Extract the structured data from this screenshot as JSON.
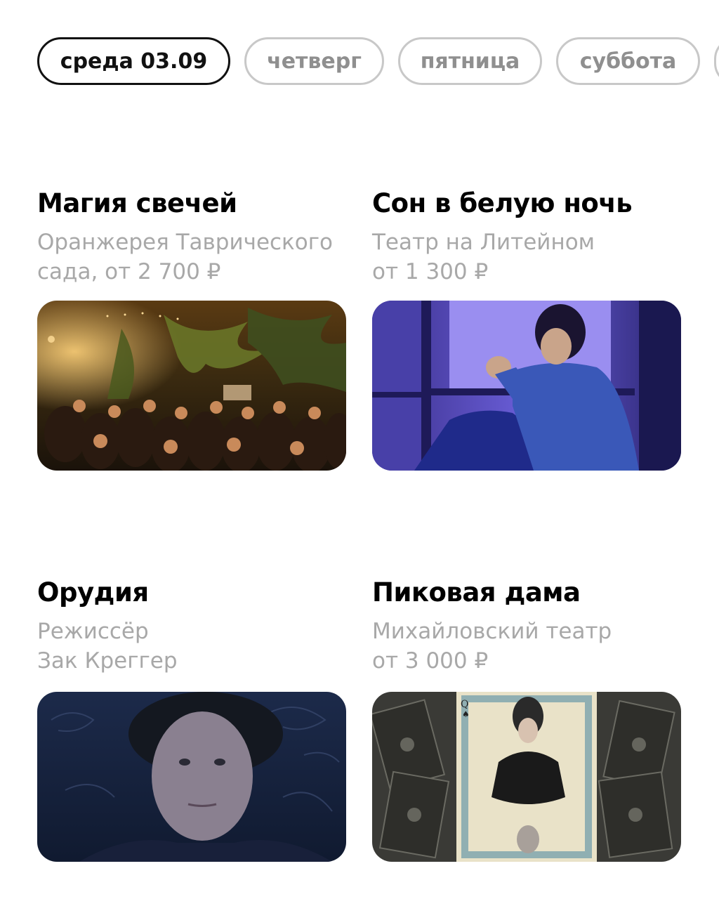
{
  "days": [
    {
      "label": "среда 03.09",
      "active": true
    },
    {
      "label": "четверг",
      "active": false
    },
    {
      "label": "пятница",
      "active": false
    },
    {
      "label": "суббота",
      "active": false
    }
  ],
  "events": [
    {
      "title": "Магия свечей",
      "line1": "Оранжерея Таврического",
      "line2": "сада, от 2 700 ₽"
    },
    {
      "title": "Сон в белую ночь",
      "line1": "Театр на Литейном",
      "line2": "от 1 300 ₽"
    },
    {
      "title": "Орудия",
      "line1": "Режиссёр",
      "line2": "Зак Креггер"
    },
    {
      "title": "Пиковая дама",
      "line1": "Михайловский театр",
      "line2": "от 3 000 ₽"
    }
  ],
  "colors": {
    "active_border": "#111111",
    "inactive_border": "#c8c8c8",
    "inactive_text": "#8f8f8f",
    "subtitle": "#a8a8a8"
  }
}
